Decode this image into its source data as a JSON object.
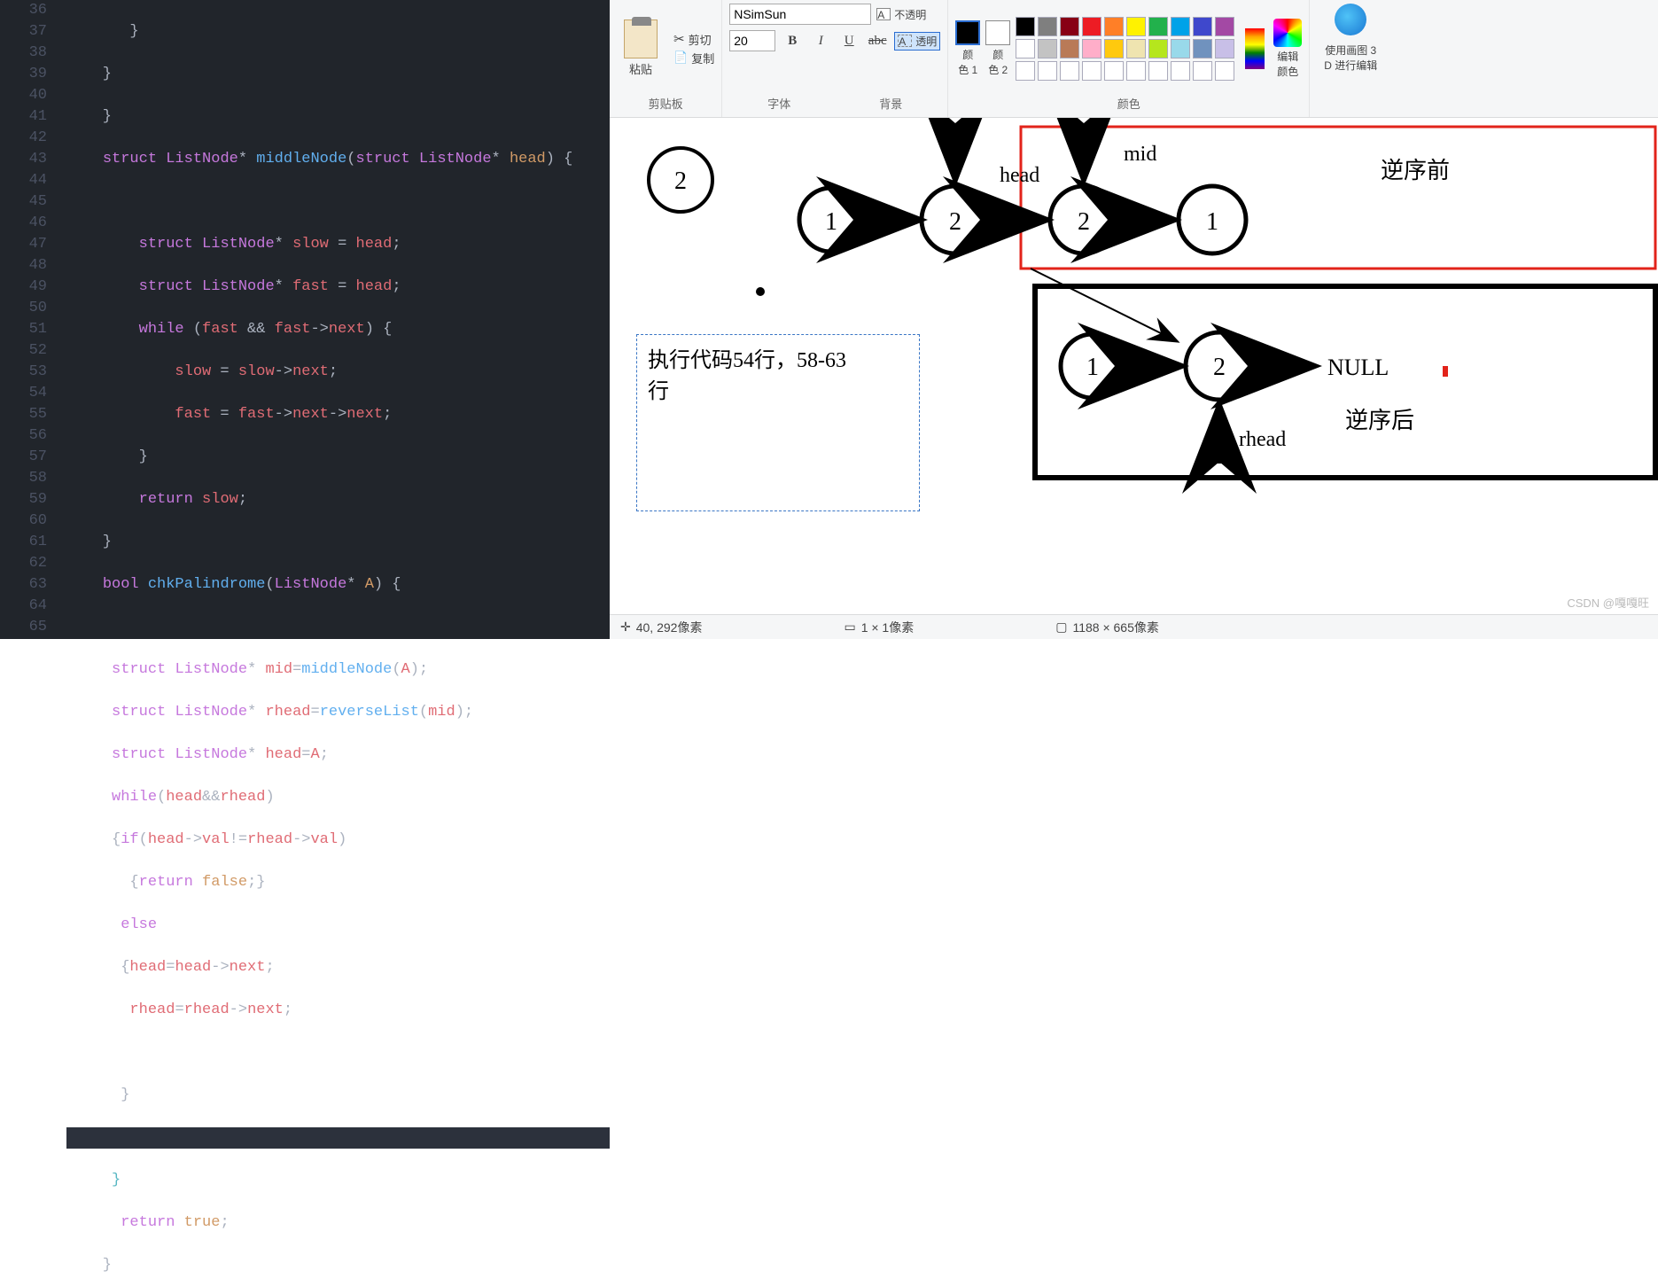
{
  "editor": {
    "lines": [
      36,
      37,
      38,
      39,
      40,
      41,
      42,
      43,
      44,
      45,
      46,
      47,
      48,
      49,
      50,
      51,
      52,
      53,
      54,
      55,
      56,
      57,
      58,
      59,
      60,
      61,
      62,
      63,
      64,
      65
    ]
  },
  "code": {
    "l39_kw": "struct",
    "l39_ty": "ListNode",
    "l39_fn": "middleNode",
    "l39_kw2": "struct",
    "l39_ty2": "ListNode",
    "l39_pa": "head",
    "l41_kw": "struct",
    "l41_ty": "ListNode",
    "l41_id": "slow",
    "l41_id2": "head",
    "l42_kw": "struct",
    "l42_ty": "ListNode",
    "l42_id": "fast",
    "l42_id2": "head",
    "l43_kw": "while",
    "l43_id": "fast",
    "l43_id2": "fast",
    "l43_id3": "next",
    "l44_id": "slow",
    "l44_id2": "slow",
    "l44_id3": "next",
    "l45_id": "fast",
    "l45_id2": "fast",
    "l45_id3": "next",
    "l45_id4": "next",
    "l47_kw": "return",
    "l47_id": "slow",
    "l49_ty": "bool",
    "l49_fn": "chkPalindrome",
    "l49_ty2": "ListNode",
    "l49_pa": "A",
    "l51_kw": "struct",
    "l51_ty": "ListNode",
    "l51_id": "mid",
    "l51_fn": "middleNode",
    "l51_id2": "A",
    "l52_kw": "struct",
    "l52_ty": "ListNode",
    "l52_id": "rhead",
    "l52_fn": "reverseList",
    "l52_id2": "mid",
    "l53_kw": "struct",
    "l53_ty": "ListNode",
    "l53_id": "head",
    "l53_id2": "A",
    "l54_kw": "while",
    "l54_id": "head",
    "l54_id2": "rhead",
    "l55_kw": "if",
    "l55_id": "head",
    "l55_id2": "val",
    "l55_id3": "rhead",
    "l55_id4": "val",
    "l56_kw": "return",
    "l56_val": "false",
    "l57_kw": "else",
    "l58_id": "head",
    "l58_id2": "head",
    "l58_id3": "next",
    "l59_id": "rhead",
    "l59_id2": "rhead",
    "l59_id3": "next",
    "l64_kw": "return",
    "l64_val": "true"
  },
  "ribbon": {
    "clipboard": {
      "paste": "粘贴",
      "cut": "剪切",
      "copy": "复制",
      "label": "剪贴板"
    },
    "font": {
      "name": "NSimSun",
      "size": "20",
      "label": "字体"
    },
    "bg": {
      "opaque": "不透明",
      "transparent": "透明",
      "label": "背景"
    },
    "colors": {
      "c1": "颜\n色 1",
      "c2": "颜\n色 2",
      "edit": "编辑\n颜色",
      "label": "颜色"
    },
    "paint3d": {
      "label": "使用画图 3\nD 进行编辑"
    },
    "palette": [
      "#000000",
      "#7f7f7f",
      "#880015",
      "#ed1c24",
      "#ff7f27",
      "#fff200",
      "#22b14c",
      "#00a2e8",
      "#3f48cc",
      "#a349a4",
      "#ffffff",
      "#c3c3c3",
      "#b97a57",
      "#ffaec9",
      "#ffc90e",
      "#efe4b0",
      "#b5e61d",
      "#99d9ea",
      "#7092be",
      "#c8bfe7",
      "#ffffff",
      "#ffffff",
      "#ffffff",
      "#ffffff",
      "#ffffff",
      "#ffffff",
      "#ffffff",
      "#ffffff",
      "#ffffff",
      "#ffffff"
    ]
  },
  "canvas": {
    "node2a": "2",
    "node1a": "1",
    "node2b": "2",
    "node2c": "2",
    "node1b": "1",
    "node1c": "1",
    "node2d": "2",
    "null": "NULL",
    "head": "head",
    "mid": "mid",
    "rhead": "rhead",
    "before": "逆序前",
    "after": "逆序后",
    "textbox": "执行代码54行，58-63\n行"
  },
  "status": {
    "pos": "40, 292像素",
    "sel": "1 × 1像素",
    "size": "1188 × 665像素"
  },
  "watermark": "CSDN @嘎嘎旺"
}
